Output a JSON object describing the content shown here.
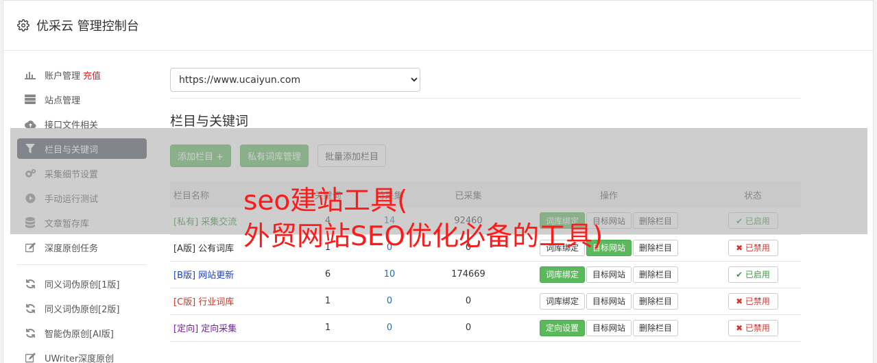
{
  "header": {
    "title": "优采云 管理控制台"
  },
  "sidebar": {
    "items": [
      {
        "label": "账户管理",
        "extra": "充值",
        "icon": "bar-chart-icon"
      },
      {
        "label": "站点管理",
        "icon": "server-icon"
      },
      {
        "label": "接口文件相关",
        "icon": "cloud-upload-icon"
      },
      {
        "label": "栏目与关键词",
        "icon": "filter-icon",
        "active": true
      },
      {
        "label": "采集细节设置",
        "icon": "cogs-icon"
      },
      {
        "label": "手动运行测试",
        "icon": "play-circle-icon"
      },
      {
        "label": "文章暂存库",
        "icon": "database-icon"
      },
      {
        "label": "深度原创任务",
        "icon": "edit-icon"
      }
    ],
    "items2": [
      {
        "label": "同义词伪原创[1版]",
        "icon": "refresh-icon"
      },
      {
        "label": "同义词伪原创[2版]",
        "icon": "refresh-icon"
      },
      {
        "label": "智能伪原创[AI版]",
        "icon": "refresh-icon"
      },
      {
        "label": "UWriter深度原创",
        "icon": "edit-icon"
      }
    ]
  },
  "main": {
    "site_select": "https://www.ucaiyun.com",
    "section_title": "栏目与关键词",
    "buttons": {
      "add": "添加栏目 +",
      "private_lib": "私有词库管理",
      "batch_add": "批量添加栏目"
    },
    "table": {
      "headers": [
        "栏目名称",
        "关键词",
        "待采集",
        "已采集",
        "操作",
        "状态"
      ],
      "rows": [
        {
          "name": "[私有] 采集交流",
          "cls": "n-private",
          "kw": "4",
          "pending": "14",
          "done": "92460",
          "op1": "词库绑定",
          "op1_green": true,
          "op2": "目标网站",
          "op2_green": false,
          "op3": "删除栏目",
          "status": "✔ 已启用",
          "on": true
        },
        {
          "name": "[A版] 公有词库",
          "cls": "n-a",
          "kw": "1",
          "pending": "0",
          "done": "0",
          "op1": "词库绑定",
          "op1_green": false,
          "op2": "目标网站",
          "op2_green": true,
          "op3": "删除栏目",
          "status": "✖ 已禁用",
          "on": false
        },
        {
          "name": "[B版] 网站更新",
          "cls": "n-b",
          "kw": "6",
          "pending": "10",
          "done": "174669",
          "op1": "词库绑定",
          "op1_green": true,
          "op2": "目标网站",
          "op2_green": false,
          "op3": "删除栏目",
          "status": "✔ 已启用",
          "on": true
        },
        {
          "name": "[C版] 行业词库",
          "cls": "n-c",
          "kw": "1",
          "pending": "0",
          "done": "0",
          "op1": "词库绑定",
          "op1_green": false,
          "op2": "目标网站",
          "op2_green": false,
          "op3": "删除栏目",
          "status": "✖ 已禁用",
          "on": false
        },
        {
          "name": "[定向] 定向采集",
          "cls": "n-d",
          "kw": "1",
          "pending": "0",
          "done": "0",
          "op1": "定向设置",
          "op1_green": true,
          "op2": "目标网站",
          "op2_green": false,
          "op3": "删除栏目",
          "status": "✖ 已禁用",
          "on": false
        }
      ]
    }
  },
  "watermark": {
    "line1": "seo建站工具(",
    "line2": "外贸网站SEO优化必备的工具)"
  }
}
